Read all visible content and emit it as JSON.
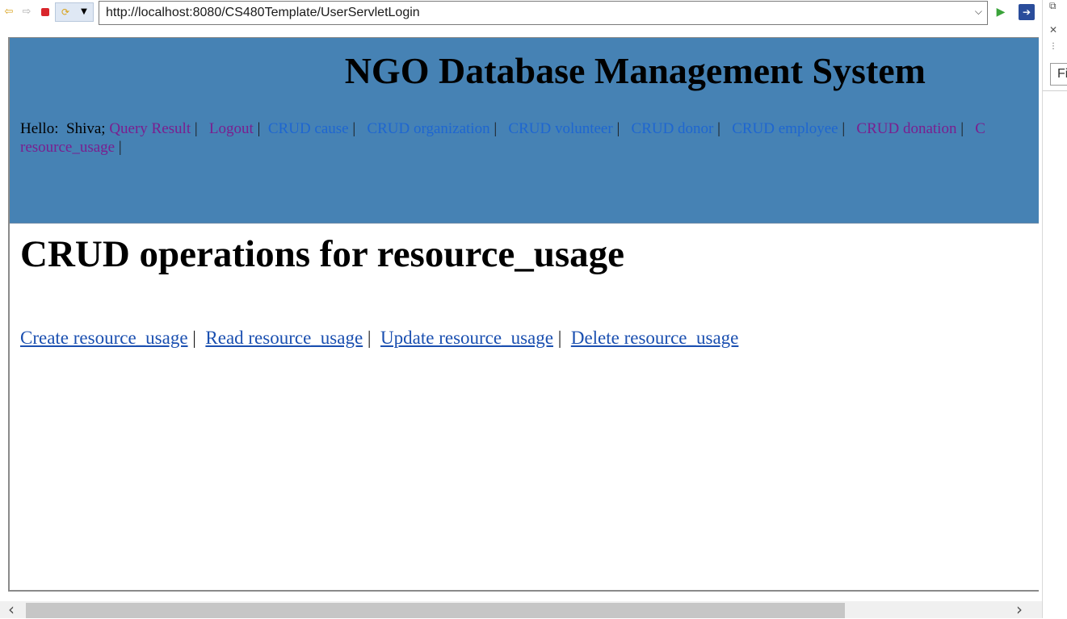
{
  "browser": {
    "url": "http://localhost:8080/CS480Template/UserServletLogin",
    "find_placeholder": "Fi"
  },
  "page": {
    "site_title": "NGO Database Management System",
    "greeting_label": "Hello:",
    "username": "Shiva;",
    "nav": {
      "query_result": "Query Result",
      "logout": "Logout",
      "crud_cause": "CRUD cause",
      "crud_organization": "CRUD organization",
      "crud_volunteer": "CRUD volunteer",
      "crud_donor": "CRUD donor",
      "crud_employee": "CRUD employee",
      "crud_donation": "CRUD donation",
      "crud_resource_usage_start": "C",
      "crud_resource_usage_rest": "resource_usage",
      "separator": "|"
    },
    "heading": "CRUD operations for resource_usage",
    "crud_links": {
      "create": "Create resource_usage",
      "read": "Read resource_usage",
      "update": "Update resource_usage",
      "delete": "Delete resource_usage",
      "separator": "|"
    }
  },
  "colors": {
    "header_bg": "#4682b4",
    "visited_link": "#7a1f8f",
    "link": "#1e66d0"
  }
}
